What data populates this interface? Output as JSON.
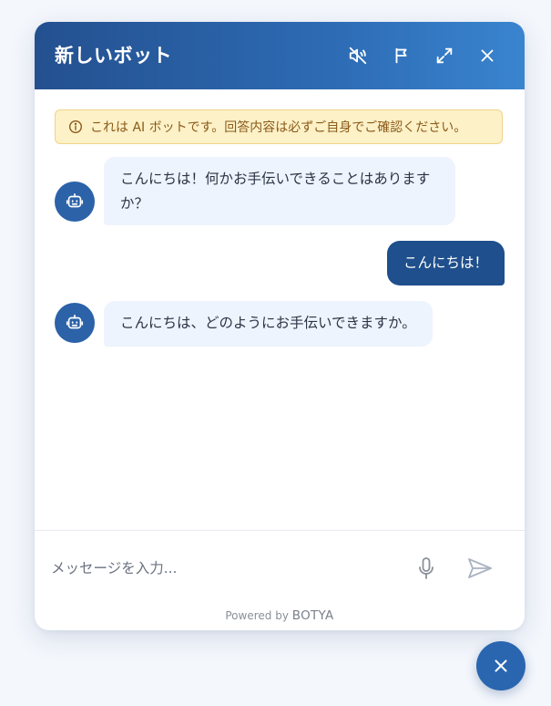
{
  "header": {
    "title": "新しいボット",
    "icons": [
      "mute-icon",
      "flag-icon",
      "expand-icon",
      "close-icon"
    ]
  },
  "notice": {
    "icon": "info-icon",
    "text": "これは AI ボットです。回答内容は必ずご自身でご確認ください。"
  },
  "messages": [
    {
      "role": "bot",
      "text": "こんにちは！何かお手伝いできることはありますか？"
    },
    {
      "role": "user",
      "text": "こんにちは！"
    },
    {
      "role": "bot",
      "text": "こんにちは、どのようにお手伝いできますか。"
    }
  ],
  "composer": {
    "placeholder": "メッセージを入力...",
    "value": ""
  },
  "footer": {
    "powered_prefix": "Powered by",
    "brand": "BOTYA"
  },
  "colors": {
    "header_start": "#24508f",
    "header_end": "#3a84cf",
    "user_bubble": "#1f4f8c",
    "bot_bubble": "#edf4fd",
    "notice_bg": "#fdf1c8",
    "fab": "#2a66b0"
  }
}
